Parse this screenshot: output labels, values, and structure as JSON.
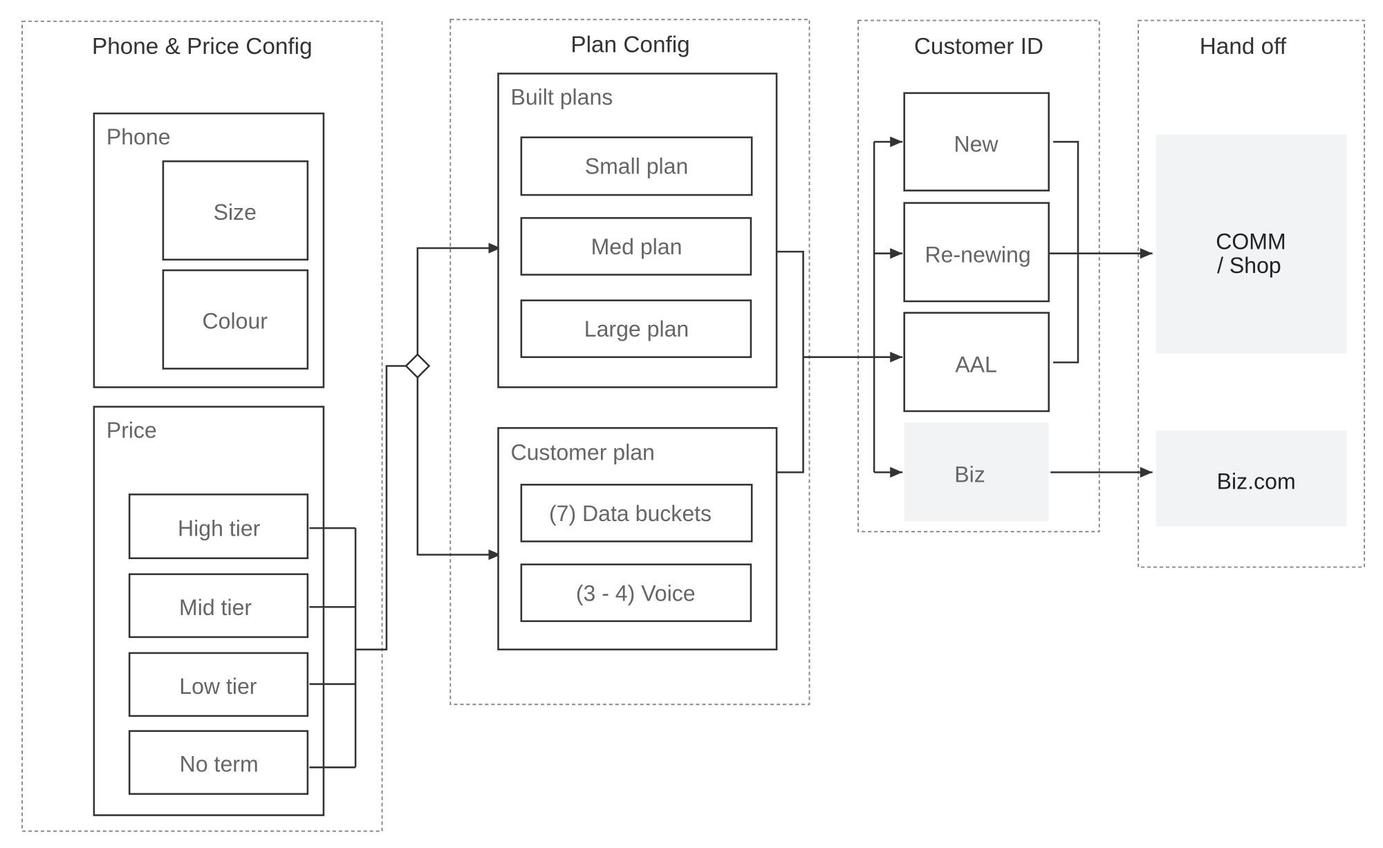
{
  "groups": {
    "phone_price": {
      "title": "Phone & Price Config"
    },
    "plan": {
      "title": "Plan Config"
    },
    "customer": {
      "title": "Customer ID"
    },
    "handoff": {
      "title": "Hand off"
    }
  },
  "phone": {
    "label": "Phone",
    "items": [
      "Size",
      "Colour"
    ]
  },
  "price": {
    "label": "Price",
    "items": [
      "High tier",
      "Mid tier",
      "Low tier",
      "No term"
    ]
  },
  "built_plans": {
    "label": "Built plans",
    "items": [
      "Small plan",
      "Med plan",
      "Large plan"
    ]
  },
  "customer_plan": {
    "label": "Customer plan",
    "items": [
      "(7) Data buckets",
      "(3 - 4) Voice"
    ]
  },
  "customer_id": {
    "items": [
      "New",
      "Re-newing",
      "AAL",
      "Biz"
    ]
  },
  "handoff": {
    "comm_line1": "COMM",
    "comm_line2": "/ Shop",
    "biz": "Biz.com"
  },
  "colors": {
    "line": "#333333",
    "fill_gray": "#f2f3f5",
    "text": "#666666"
  }
}
